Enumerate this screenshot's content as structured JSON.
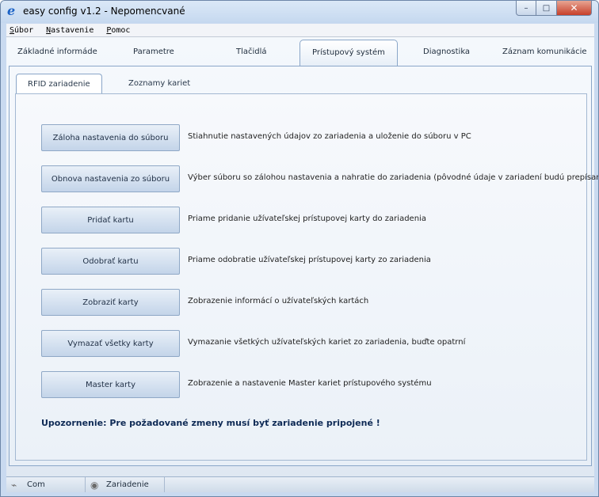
{
  "window": {
    "title": "easy config v1.2 - Nepomencvané",
    "icon": "e-logo-icon",
    "controls": {
      "minimize": "–",
      "maximize": "□",
      "close": "✕"
    }
  },
  "menu": [
    {
      "mnemonic": "S",
      "rest": "úbor"
    },
    {
      "mnemonic": "N",
      "rest": "astavenie"
    },
    {
      "mnemonic": "P",
      "rest": "omoc"
    }
  ],
  "tabs": [
    {
      "label": "Základné informáde"
    },
    {
      "label": "Parametre"
    },
    {
      "label": "Tlačidlá"
    },
    {
      "label": "Prístupový systém",
      "active": true
    },
    {
      "label": "Diagnostika"
    },
    {
      "label": "Záznam komunikácie"
    }
  ],
  "subtabs": [
    {
      "label": "RFID zariadenie",
      "active": true
    },
    {
      "label": "Zoznamy kariet"
    }
  ],
  "actions": [
    {
      "button": "Záloha nastavenia do súboru",
      "description": "Stiahnutie nastavených údajov zo zariadenia a uloženie do súboru v PC"
    },
    {
      "button": "Obnova nastavenia zo súboru",
      "description": "Výber súboru so zálohou nastavenia a nahratie do zariadenia (pôvodné údaje v zariadení budú prepísané)"
    },
    {
      "button": "Pridať kartu",
      "description": "Priame pridanie užívateľskej prístupovej karty do zariadenia"
    },
    {
      "button": "Odobrať kartu",
      "description": "Priame odobratie užívateľskej prístupovej karty zo zariadenia"
    },
    {
      "button": "Zobraziť karty",
      "description": "Zobrazenie informácí o užívateľských kartách"
    },
    {
      "button": "Vymazať všetky karty",
      "description": "Vymazanie všetkých užívateľských kariet zo zariadenia, buďte opatrní"
    },
    {
      "button": "Master karty",
      "description": "Zobrazenie a nastavenie Master kariet prístupového systému"
    }
  ],
  "warning": "Upozornenie: Pre požadované zmeny musí byť zariadenie pripojené !",
  "status": {
    "com": {
      "label": "Com",
      "icon": "plug-icon"
    },
    "device": {
      "label": "Zariadenie",
      "icon": "device-icon"
    }
  }
}
